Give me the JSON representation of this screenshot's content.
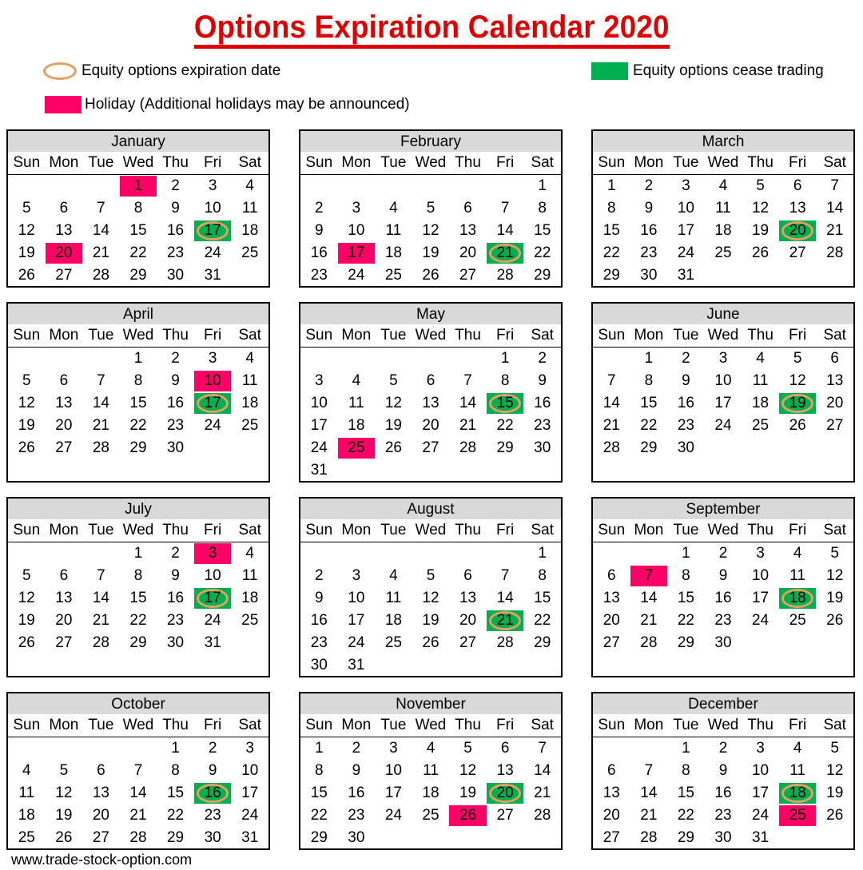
{
  "title": "Options Expiration Calendar 2020",
  "legend": {
    "expiration": "Equity options expiration date",
    "cease": "Equity options cease trading",
    "holiday": "Holiday (Additional holidays may be announced)"
  },
  "colors": {
    "title": "#e00000",
    "holiday": "#ff0066",
    "cease": "#00b050",
    "expiration_ring": "#e0a060",
    "header": "#d9d9d9"
  },
  "weekdays": [
    "Sun",
    "Mon",
    "Tue",
    "Wed",
    "Thu",
    "Fri",
    "Sat"
  ],
  "year": 2020,
  "months": [
    {
      "name": "January",
      "first_weekday": 3,
      "days": 31,
      "holidays": [
        1,
        20
      ],
      "expiration": [
        17
      ]
    },
    {
      "name": "February",
      "first_weekday": 6,
      "days": 29,
      "holidays": [
        17
      ],
      "expiration": [
        21
      ]
    },
    {
      "name": "March",
      "first_weekday": 0,
      "days": 31,
      "holidays": [],
      "expiration": [
        20
      ]
    },
    {
      "name": "April",
      "first_weekday": 3,
      "days": 30,
      "holidays": [
        10
      ],
      "expiration": [
        17
      ]
    },
    {
      "name": "May",
      "first_weekday": 5,
      "days": 31,
      "holidays": [
        25
      ],
      "expiration": [
        15
      ]
    },
    {
      "name": "June",
      "first_weekday": 1,
      "days": 30,
      "holidays": [],
      "expiration": [
        19
      ]
    },
    {
      "name": "July",
      "first_weekday": 3,
      "days": 31,
      "holidays": [
        3
      ],
      "expiration": [
        17
      ]
    },
    {
      "name": "August",
      "first_weekday": 6,
      "days": 31,
      "holidays": [],
      "expiration": [
        21
      ]
    },
    {
      "name": "September",
      "first_weekday": 2,
      "days": 30,
      "holidays": [
        7
      ],
      "expiration": [
        18
      ]
    },
    {
      "name": "October",
      "first_weekday": 4,
      "days": 31,
      "holidays": [],
      "expiration": [
        16
      ]
    },
    {
      "name": "November",
      "first_weekday": 0,
      "days": 30,
      "holidays": [
        26
      ],
      "expiration": [
        20
      ]
    },
    {
      "name": "December",
      "first_weekday": 2,
      "days": 31,
      "holidays": [
        25
      ],
      "expiration": [
        18
      ]
    }
  ],
  "footer": "www.trade-stock-option.com"
}
